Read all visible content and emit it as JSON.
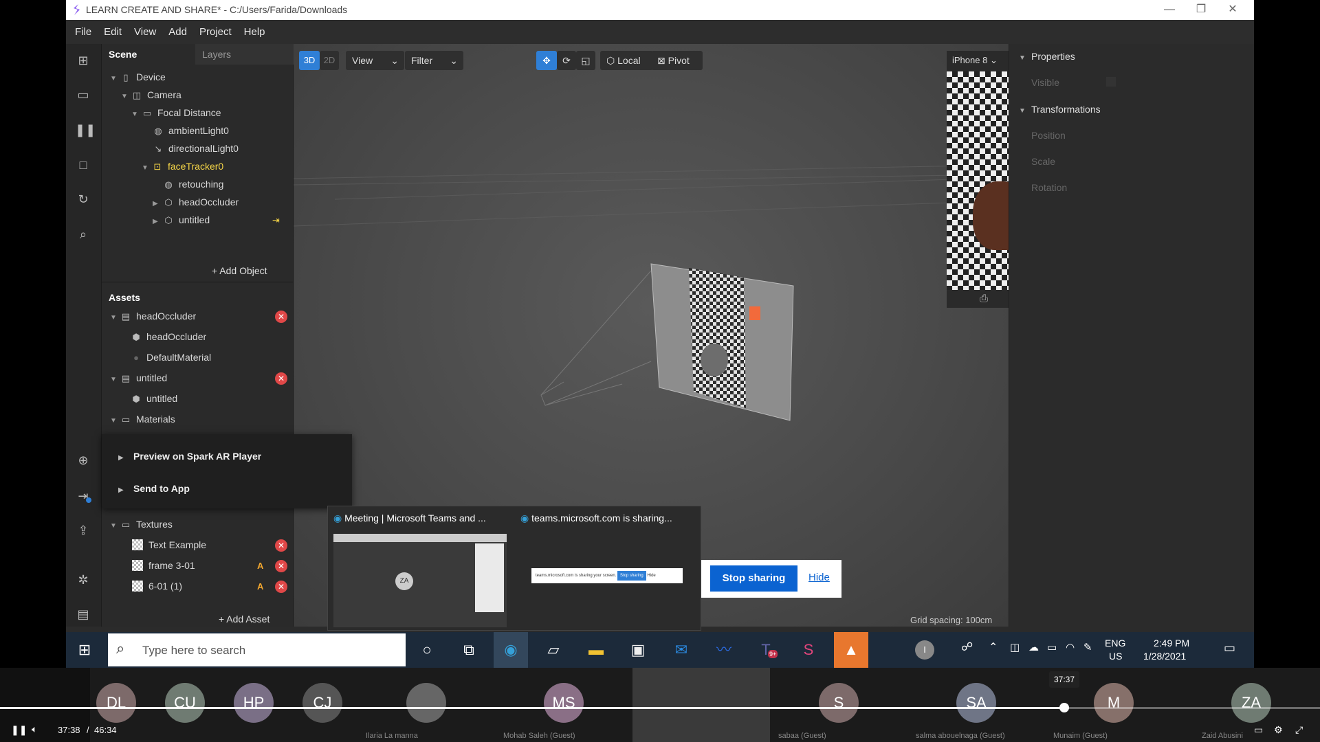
{
  "app": {
    "title": "LEARN CREATE AND SHARE* - C:/Users/Farida/Downloads",
    "menu": [
      "File",
      "Edit",
      "View",
      "Add",
      "Project",
      "Help"
    ]
  },
  "scene": {
    "tabs": [
      "Scene",
      "Layers"
    ],
    "tree": [
      {
        "label": "Device",
        "indent": 0,
        "arrow": "▼",
        "icon": "▯"
      },
      {
        "label": "Camera",
        "indent": 1,
        "arrow": "▼",
        "icon": "◫"
      },
      {
        "label": "Focal Distance",
        "indent": 2,
        "arrow": "▼",
        "icon": "▭"
      },
      {
        "label": "ambientLight0",
        "indent": 3,
        "arrow": "",
        "icon": "◍"
      },
      {
        "label": "directionalLight0",
        "indent": 3,
        "arrow": "",
        "icon": "↘"
      },
      {
        "label": "faceTracker0",
        "indent": 3,
        "arrow": "▼",
        "icon": "⊡",
        "highlight": true
      },
      {
        "label": "retouching",
        "indent": 4,
        "arrow": "",
        "icon": "◍"
      },
      {
        "label": "headOccluder",
        "indent": 4,
        "arrow": "▶",
        "icon": "⬡"
      },
      {
        "label": "untitled",
        "indent": 4,
        "arrow": "▶",
        "icon": "⬡"
      }
    ],
    "add_object": "+ Add Object"
  },
  "assets": {
    "header": "Assets",
    "rows": [
      {
        "label": "headOccluder",
        "indent": 0,
        "arrow": "▼",
        "icon": "file",
        "remove": true
      },
      {
        "label": "headOccluder",
        "indent": 1,
        "arrow": "",
        "icon": "cube"
      },
      {
        "label": "DefaultMaterial",
        "indent": 1,
        "arrow": "",
        "icon": "sphere"
      },
      {
        "label": "untitled",
        "indent": 0,
        "arrow": "▼",
        "icon": "file",
        "remove": true
      },
      {
        "label": "untitled",
        "indent": 1,
        "arrow": "",
        "icon": "cube"
      },
      {
        "label": "Materials",
        "indent": 0,
        "arrow": "▼",
        "icon": "folder"
      }
    ],
    "textures_header": "Textures",
    "textures": [
      {
        "label": "Text Example",
        "badge": ""
      },
      {
        "label": "frame 3-01",
        "badge": "A"
      },
      {
        "label": "6-01 (1)",
        "badge": "A"
      }
    ],
    "add_asset": "+ Add Asset"
  },
  "context_menu": {
    "items": [
      "Preview on Spark AR Player",
      "Send to App"
    ]
  },
  "viewport": {
    "mode_3d": "3D",
    "mode_2d": "2D",
    "view": "View",
    "filter": "Filter",
    "local": "Local",
    "pivot": "Pivot",
    "grid_spacing": "Grid spacing: 100cm"
  },
  "simulator": {
    "device": "iPhone 8"
  },
  "properties": {
    "header": "Properties",
    "visible": "Visible",
    "transformations": "Transformations",
    "position": "Position",
    "scale": "Scale",
    "rotation": "Rotation"
  },
  "thumbs": {
    "left_title": "Meeting | Microsoft Teams and ...",
    "right_title": "teams.microsoft.com is sharing...",
    "mini_text": "teams.microsoft.com is sharing your screen.",
    "mini_stop": "Stop sharing",
    "mini_hide": "Hide",
    "avatar": "ZA"
  },
  "share_bar": {
    "stop": "Stop sharing",
    "hide": "Hide"
  },
  "taskbar": {
    "search_placeholder": "Type here to search",
    "lang": "ENG",
    "region": "US",
    "time": "2:49 PM",
    "date": "1/28/2021",
    "user_initial": "I",
    "teams_badge": "9+"
  },
  "participants": [
    {
      "initials": "DL",
      "name": ""
    },
    {
      "initials": "CU",
      "name": ""
    },
    {
      "initials": "HP",
      "name": ""
    },
    {
      "initials": "CJ",
      "name": ""
    },
    {
      "initials": "",
      "name": "Ilaria  La manna"
    },
    {
      "initials": "MS",
      "name": "Mohab Saleh (Guest)"
    },
    {
      "initials": "",
      "name": ""
    },
    {
      "initials": "S",
      "name": "sabaa (Guest)"
    },
    {
      "initials": "SA",
      "name": "salma abouelnaga (Guest)"
    },
    {
      "initials": "M",
      "name": "Munaim (Guest)"
    },
    {
      "initials": "ZA",
      "name": "Zaid Abusini"
    }
  ],
  "video": {
    "current": "37:38",
    "separator": "/",
    "total": "46:34",
    "tooltip": "37:37",
    "progress": 0.806
  },
  "colors": {
    "accent_blue": "#2f7fd6",
    "highlight_yellow": "#f5d547",
    "remove_red": "#e04848",
    "badge_orange": "#f1a62f"
  }
}
